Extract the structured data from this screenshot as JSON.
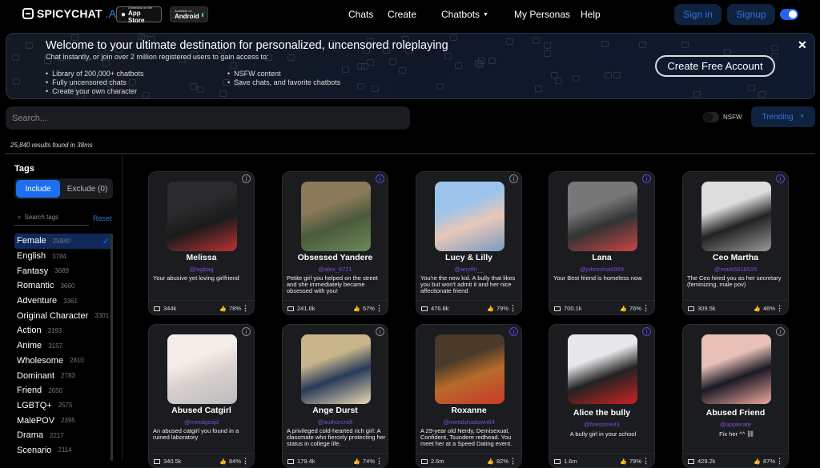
{
  "header": {
    "logo_text": "SPICYCHAT",
    "logo_suffix": ".AI",
    "appstore_small": "Download on the",
    "appstore_big": "App Store",
    "android_small": "Available on",
    "android_big": "Android",
    "nav": [
      "Chats",
      "Create",
      "Chatbots",
      "My Personas",
      "Help"
    ],
    "signin": "Sign in",
    "signup": "Signup"
  },
  "banner": {
    "title": "Welcome to your ultimate destination for personalized, uncensored roleplaying",
    "subtitle": "Chat instantly, or join over 2 million registered users to gain access to:",
    "list_left": [
      "Library of 200,000+ chatbots",
      "Fully uncensored chats",
      "Create your own character"
    ],
    "list_right": [
      "NSFW content",
      "Save chats, and favorite chatbots"
    ],
    "cta": "Create Free Account",
    "close": "✕"
  },
  "search": {
    "placeholder": "Search...",
    "nsfw_label": "NSFW",
    "sort": "Trending",
    "results": "25,840 results found in 38ms"
  },
  "tags": {
    "title": "Tags",
    "include": "Include",
    "exclude": "Exclude (0)",
    "search_placeholder": "Search tags",
    "reset": "Reset",
    "items": [
      {
        "name": "Female",
        "count": "25840",
        "selected": true
      },
      {
        "name": "English",
        "count": "3784"
      },
      {
        "name": "Fantasy",
        "count": "3689"
      },
      {
        "name": "Romantic",
        "count": "3660"
      },
      {
        "name": "Adventure",
        "count": "3361"
      },
      {
        "name": "Original Character",
        "count": "3301"
      },
      {
        "name": "Action",
        "count": "3193"
      },
      {
        "name": "Anime",
        "count": "3157"
      },
      {
        "name": "Wholesome",
        "count": "2810"
      },
      {
        "name": "Dominant",
        "count": "2783"
      },
      {
        "name": "Friend",
        "count": "2650"
      },
      {
        "name": "LGBTQ+",
        "count": "2575"
      },
      {
        "name": "MalePOV",
        "count": "2395"
      },
      {
        "name": "Drama",
        "count": "2217"
      },
      {
        "name": "Scenario",
        "count": "2114"
      }
    ]
  },
  "cards": [
    {
      "name": "Melissa",
      "handle": "@lagbag",
      "desc": "Your abusive yet loving girlfriend",
      "messages": "344k",
      "rating": "78%",
      "info_blue": false,
      "colors": [
        "#2b2b2e",
        "#1a1a1a",
        "#b33"
      ]
    },
    {
      "name": "Obsessed Yandere",
      "handle": "@alex_6721",
      "desc": "Petite girl you helped on the street and she immediately became obsessed with you!",
      "messages": "241.6k",
      "rating": "57%",
      "info_blue": true,
      "colors": [
        "#8a7a5a",
        "#4a5a3a",
        "#6a8a5a"
      ]
    },
    {
      "name": "Lucy & Lilly",
      "handle": "@anythi__",
      "desc": "You're the new kid. A bully that likes you but won't admit it and her nice affectionate friend",
      "messages": "476.8k",
      "rating": "79%",
      "info_blue": false,
      "colors": [
        "#9cc4ea",
        "#e8c8b8",
        "#7a9ac0"
      ]
    },
    {
      "name": "Lana",
      "handle": "@johncena6969",
      "desc": "Your Best friend is homeless now",
      "messages": "700.1k",
      "rating": "76%",
      "info_blue": true,
      "colors": [
        "#777",
        "#333",
        "#c44"
      ]
    },
    {
      "name": "Ceo Martha",
      "handle": "@mark5616515",
      "desc": "The Ceo hired you as her secretary (feminizing, male pov)",
      "messages": "309.5k",
      "rating": "46%",
      "info_blue": true,
      "colors": [
        "#ddd",
        "#222",
        "#999"
      ]
    },
    {
      "name": "Abused Catgirl",
      "handle": "@rreedgesjd",
      "desc": "An abused catgirl you found in a ruined laboratory",
      "messages": "340.5k",
      "rating": "84%",
      "info_blue": false,
      "colors": [
        "#f4eeea",
        "#d8d0cc",
        "#bbb"
      ]
    },
    {
      "name": "Ange Durst",
      "handle": "@authorcraft",
      "desc": "A privileged cold-hearted rich girl: A classmate who fiercely protecting her status in college life.",
      "messages": "179.4k",
      "rating": "74%",
      "info_blue": false,
      "colors": [
        "#c8b48a",
        "#283a5a",
        "#e8d8b0"
      ]
    },
    {
      "name": "Roxanne",
      "handle": "@metalshadown64",
      "desc": "A 29-year old Nerdy, Demisexual, Confident, Tsundere redhead. You meet her at a Speed Dating event.",
      "messages": "2.6m",
      "rating": "82%",
      "info_blue": true,
      "colors": [
        "#4a3a2a",
        "#b86a2a",
        "#c83a2a"
      ]
    },
    {
      "name": "Alice the bully",
      "handle": "@firestone43",
      "desc": "A bully girl in your school",
      "messages": "1.6m",
      "rating": "79%",
      "info_blue": true,
      "colors": [
        "#e8e8ec",
        "#222",
        "#c22"
      ]
    },
    {
      "name": "Abused Friend",
      "handle": "@applerate",
      "desc": "Fix her ^^ ⛓",
      "messages": "429.2k",
      "rating": "87%",
      "info_blue": false,
      "colors": [
        "#e8c0b8",
        "#1a1a24",
        "#f0a8a0"
      ]
    }
  ]
}
